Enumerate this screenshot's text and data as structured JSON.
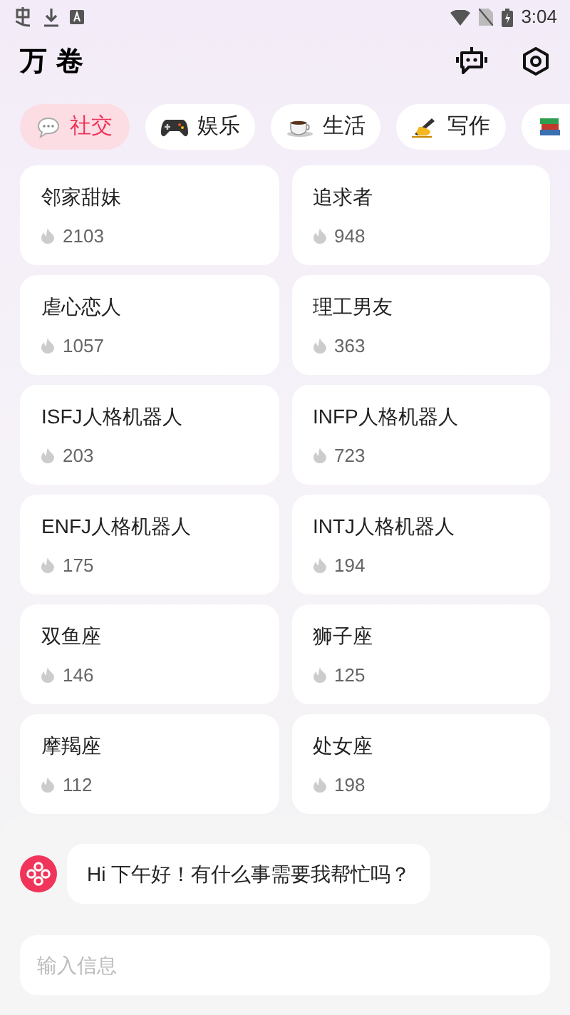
{
  "status_bar": {
    "time": "3:04"
  },
  "header": {
    "title": "万 卷"
  },
  "tabs": [
    {
      "label": "社交",
      "kind": "chat",
      "selected": true
    },
    {
      "label": "娱乐",
      "kind": "gamepad",
      "selected": false
    },
    {
      "label": "生活",
      "kind": "coffee",
      "selected": false
    },
    {
      "label": "写作",
      "kind": "pen",
      "selected": false
    },
    {
      "kind": "books",
      "selected": false
    }
  ],
  "cards": [
    {
      "title": "邻家甜妹",
      "count": "2103"
    },
    {
      "title": "追求者",
      "count": "948"
    },
    {
      "title": "虐心恋人",
      "count": "1057"
    },
    {
      "title": "理工男友",
      "count": "363"
    },
    {
      "title": "ISFJ人格机器人",
      "count": "203"
    },
    {
      "title": "INFP人格机器人",
      "count": "723"
    },
    {
      "title": "ENFJ人格机器人",
      "count": "175"
    },
    {
      "title": "INTJ人格机器人",
      "count": "194"
    },
    {
      "title": "双鱼座",
      "count": "146"
    },
    {
      "title": "狮子座",
      "count": "125"
    },
    {
      "title": "摩羯座",
      "count": "112"
    },
    {
      "title": "处女座",
      "count": "198"
    }
  ],
  "chat": {
    "message": "Hi 下午好！有什么事需要我帮忙吗？",
    "input": {
      "placeholder": "输入信息"
    }
  }
}
